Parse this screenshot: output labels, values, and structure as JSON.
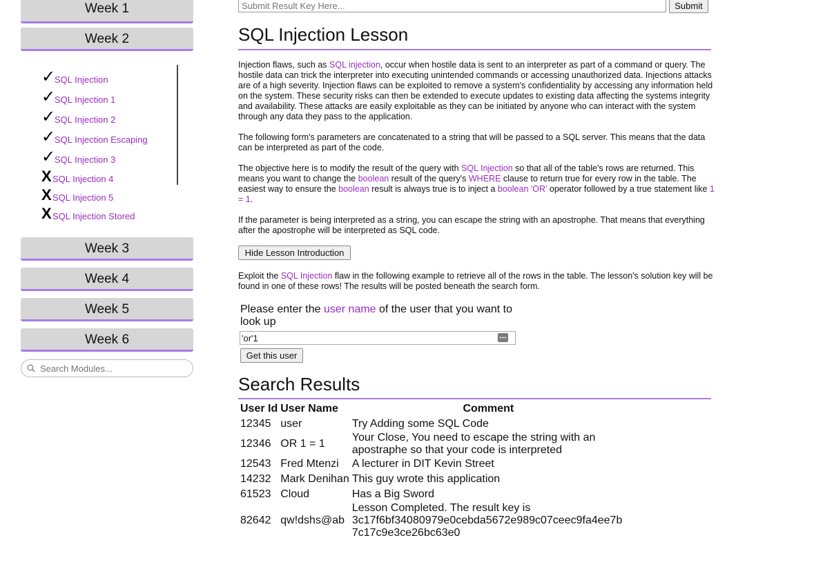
{
  "sidebar": {
    "weeks_top": [
      "Week 1",
      "Week 2"
    ],
    "sub_items": [
      {
        "mark": "✓",
        "label": "SQL Injection"
      },
      {
        "mark": "✓",
        "label": "SQL Injection 1"
      },
      {
        "mark": "✓",
        "label": "SQL Injection 2"
      },
      {
        "mark": "✓",
        "label": "SQL Injection Escaping"
      },
      {
        "mark": "✓",
        "label": "SQL Injection 3"
      },
      {
        "mark": "X",
        "label": "SQL Injection 4"
      },
      {
        "mark": "X",
        "label": "SQL Injection 5"
      },
      {
        "mark": "X",
        "label": "SQL Injection Stored"
      }
    ],
    "weeks_bottom": [
      "Week 3",
      "Week 4",
      "Week 5",
      "Week 6"
    ],
    "search_placeholder": "Search Modules..."
  },
  "result_key": {
    "placeholder": "Submit Result Key Here...",
    "submit_label": "Submit"
  },
  "lesson": {
    "title": "SQL Injection Lesson",
    "p1": {
      "t1": "Injection flaws, such as ",
      "l1": "SQL injection",
      "t2": ", occur when hostile data is sent to an interpreter as part of a command or query. The hostile data can trick the interpreter into executing unintended commands or accessing unauthorized data. Injections attacks are of a high severity. Injection flaws can be exploited to remove a system's confidentiality by accessing any information held on the system. These security risks can then be extended to execute updates to existing data affecting the systems integrity and availability. These attacks are easily exploitable as they can be initiated by anyone who can interact with the system through any data they pass to the application."
    },
    "p2": "The following form's parameters are concatenated to a string that will be passed to a SQL server. This means that the data can be interpreted as part of the code.",
    "p3": {
      "t1": "The objective here is to modify the result of the query with ",
      "l1": "SQL Injection",
      "t2": " so that all of the table's rows are returned. This means you want to change the ",
      "l2": "boolean",
      "t3": " result of the query's ",
      "l3": "WHERE",
      "t4": " clause to return true for every row in the table. The easiest way to ensure the ",
      "l4": "boolean",
      "t5": " result is always true is to inject a ",
      "l5": "boolean 'OR'",
      "t6": " operator followed by a true statement like ",
      "l6": "1 = 1",
      "t7": "."
    },
    "p4": "If the parameter is being interpreted as a string, you can escape the string with an apostrophe. That means that everything after the apostrophe will be interpreted as SQL code.",
    "hide_button": "Hide Lesson Introduction",
    "p5": {
      "t1": "Exploit the ",
      "l1": "SQL Injection",
      "t2": " flaw in the following example to retrieve all of the rows in the table. The lesson's solution key will be found in one of these rows! The results will be posted beneath the search form."
    },
    "lookup": {
      "t1": "Please enter the ",
      "l1": "user name",
      "t2": " of the user that you want to look up"
    },
    "name_value": "'or'1",
    "get_button": "Get this user"
  },
  "results": {
    "title": "Search Results",
    "headers": [
      "User Id",
      "User Name",
      "Comment"
    ],
    "rows": [
      [
        "12345",
        "user",
        "Try Adding some SQL Code"
      ],
      [
        "12346",
        "OR 1 = 1",
        "Your Close, You need to escape the string with an apostraphe so that your code is interpreted"
      ],
      [
        "12543",
        "Fred Mtenzi",
        "A lecturer in DIT Kevin Street"
      ],
      [
        "14232",
        "Mark Denihan",
        "This guy wrote this application"
      ],
      [
        "61523",
        "Cloud",
        "Has a Big Sword"
      ],
      [
        "82642",
        "qw!dshs@ab",
        "Lesson Completed. The result key is 3c17f6bf34080979e0cebda5672e989c07ceec9fa4ee7b 7c17c9e3ce26bc63e0"
      ]
    ]
  }
}
